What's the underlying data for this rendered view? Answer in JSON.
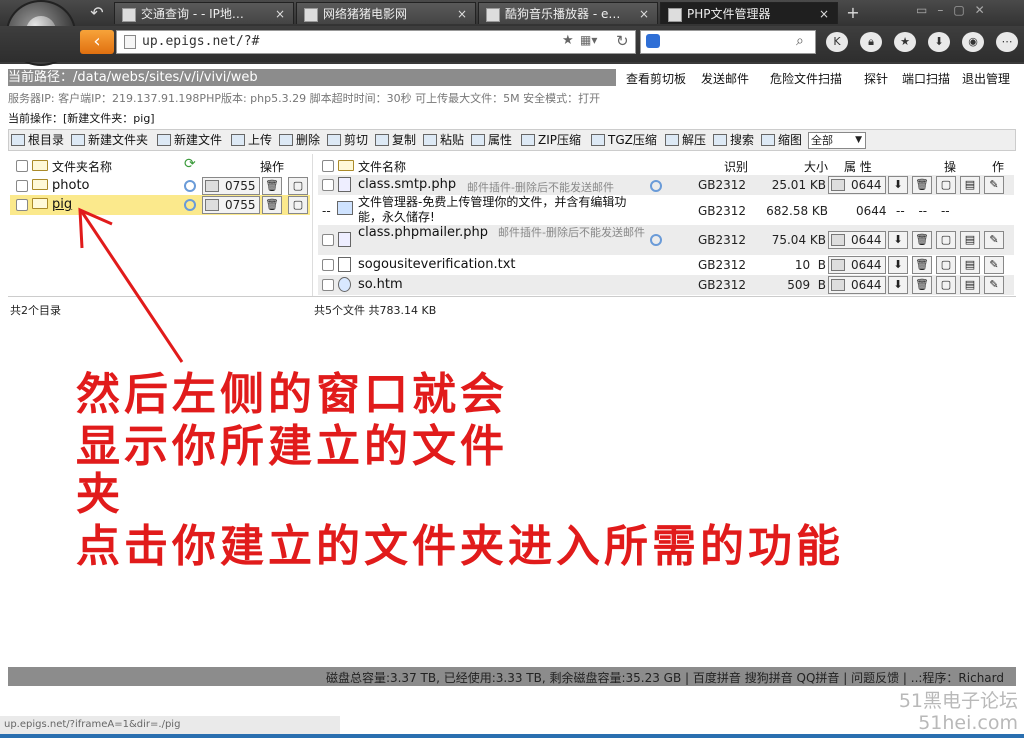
{
  "browser": {
    "tabs": [
      {
        "label": "交通查询 - - IP地…",
        "close": "×"
      },
      {
        "label": "网络猪猪电影网",
        "close": "×"
      },
      {
        "label": "酷狗音乐播放器 - e…",
        "close": "×"
      },
      {
        "label": "PHP文件管理器",
        "close": "×"
      }
    ],
    "new_tab": "+",
    "url": "up.epigs.net/?#",
    "toolbar_icons": [
      "K",
      "lock-icon",
      "star-icon",
      "download-icon",
      "gamepad-icon",
      "menu-icon"
    ]
  },
  "page": {
    "current_path_label": "当前路径：/data/webs/sites/v/i/vivi/web",
    "top_links": [
      "查看剪切板",
      "发送邮件",
      "危险文件扫描",
      "探针",
      "端口扫描",
      "退出管理"
    ],
    "server_info": "服务器IP: 客户端IP：219.137.91.198PHP版本: php5.3.29 脚本超时时间：30秒 可上传最大文件：5M 安全模式：打开",
    "current_op": "当前操作：[新建文件夹：pig]",
    "toolbar": [
      "根目录",
      "新建文件夹",
      "新建文件",
      "上传",
      "删除",
      "剪切",
      "复制",
      "粘贴",
      "属性",
      "ZIP压缩",
      "TGZ压缩",
      "解压",
      "搜索",
      "缩图"
    ],
    "select_value": "全部",
    "left": {
      "header_name": "文件夹名称",
      "header_ops": "操作",
      "folders": [
        {
          "name": "photo",
          "perm": "0755"
        },
        {
          "name": "pig",
          "perm": "0755"
        }
      ],
      "summary": "共2个目录"
    },
    "right": {
      "header_name": "文件名称",
      "header_enc": "识别",
      "header_size": "大小",
      "header_attr": "属 性",
      "header_op1": "操",
      "header_op2": "作",
      "files": [
        {
          "name": "class.smtp.php",
          "note": "邮件插件-删除后不能发送邮件",
          "enc": "GB2312",
          "size": "25.01 KB",
          "perm": "0644"
        },
        {
          "name": "文件管理器-免费上传管理你的文件，并含有编辑功能，永久储存!",
          "note": "",
          "enc": "GB2312",
          "size": "682.58 KB",
          "perm": "0644",
          "dashes": "-- -- --"
        },
        {
          "name": "class.phpmailer.php",
          "note": "邮件插件-删除后不能发送邮件",
          "enc": "GB2312",
          "size": "75.04 KB",
          "perm": "0644"
        },
        {
          "name": "sogousiteverification.txt",
          "note": "",
          "enc": "GB2312",
          "size": "10  B",
          "perm": "0644"
        },
        {
          "name": "so.htm",
          "note": "",
          "enc": "GB2312",
          "size": "509  B",
          "perm": "0644"
        }
      ],
      "summary": "共5个文件 共783.14 KB"
    },
    "footer": "磁盘总容量:3.37 TB, 已经使用:3.33 TB, 剩余磁盘容量:35.23 GB | 百度拼音 搜狗拼音 QQ拼音 | 问题反馈 | ..:程序：Richard",
    "status_url": "up.epigs.net/?iframeA=1&dir=./pig"
  },
  "annotation": {
    "line1": "然后左侧的窗口就会",
    "line2": "显示你所建立的文件",
    "line3": "夹",
    "line4": "点击你建立的文件夹进入所需的功能"
  },
  "watermark": {
    "line1": "51黑电子论坛",
    "line2": "51hei.com"
  },
  "colors": {
    "accent_orange": "#f08a1c",
    "annotation_red": "#e11b1b",
    "selected_row": "#fbe98c",
    "bar_gray": "#8c8c8c"
  }
}
